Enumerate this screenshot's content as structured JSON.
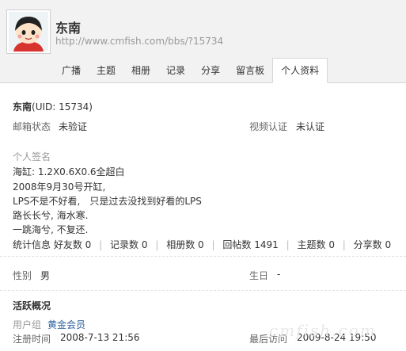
{
  "user": {
    "name": "东南",
    "url": "http://www.cmfish.com/bbs/?15734"
  },
  "tabs": [
    {
      "label": "广播"
    },
    {
      "label": "主题"
    },
    {
      "label": "相册"
    },
    {
      "label": "记录"
    },
    {
      "label": "分享"
    },
    {
      "label": "留言板"
    },
    {
      "label": "个人资料",
      "active": true
    }
  ],
  "profile": {
    "uid_text": "(UID: 15734)",
    "email_label": "邮箱状态",
    "email_value": "未验证",
    "video_label": "视频认证",
    "video_value": "未认证",
    "signature_label": "个人签名",
    "signature_lines": [
      "海缸: 1.2X0.6X0.6全超白",
      "2008年9月30号开缸,",
      "LPS不是不好看,　只是过去没找到好看的LPS",
      "路长长兮, 海水寒.",
      "一跳海兮, 不复还."
    ],
    "stats": [
      {
        "label": "统计信息 好友数",
        "value": "0"
      },
      {
        "label": "记录数",
        "value": "0"
      },
      {
        "label": "相册数",
        "value": "0"
      },
      {
        "label": "回帖数",
        "value": "1491"
      },
      {
        "label": "主题数",
        "value": "0"
      },
      {
        "label": "分享数",
        "value": "0"
      }
    ],
    "gender_label": "性别",
    "gender_value": "男",
    "birthday_label": "生日",
    "birthday_value": "-"
  },
  "activity": {
    "title": "活跃概况",
    "group_label": "用户组",
    "group_value": "黄金会员",
    "register_label": "注册时间",
    "register_value": "2008-7-13 21:56",
    "last_visit_label": "最后访问",
    "last_visit_value": "2009-8-24 19:50"
  },
  "watermark": "cmfish.com",
  "colors": {
    "link": "#2b5f9e",
    "header_bg": "#f2f2f2"
  }
}
